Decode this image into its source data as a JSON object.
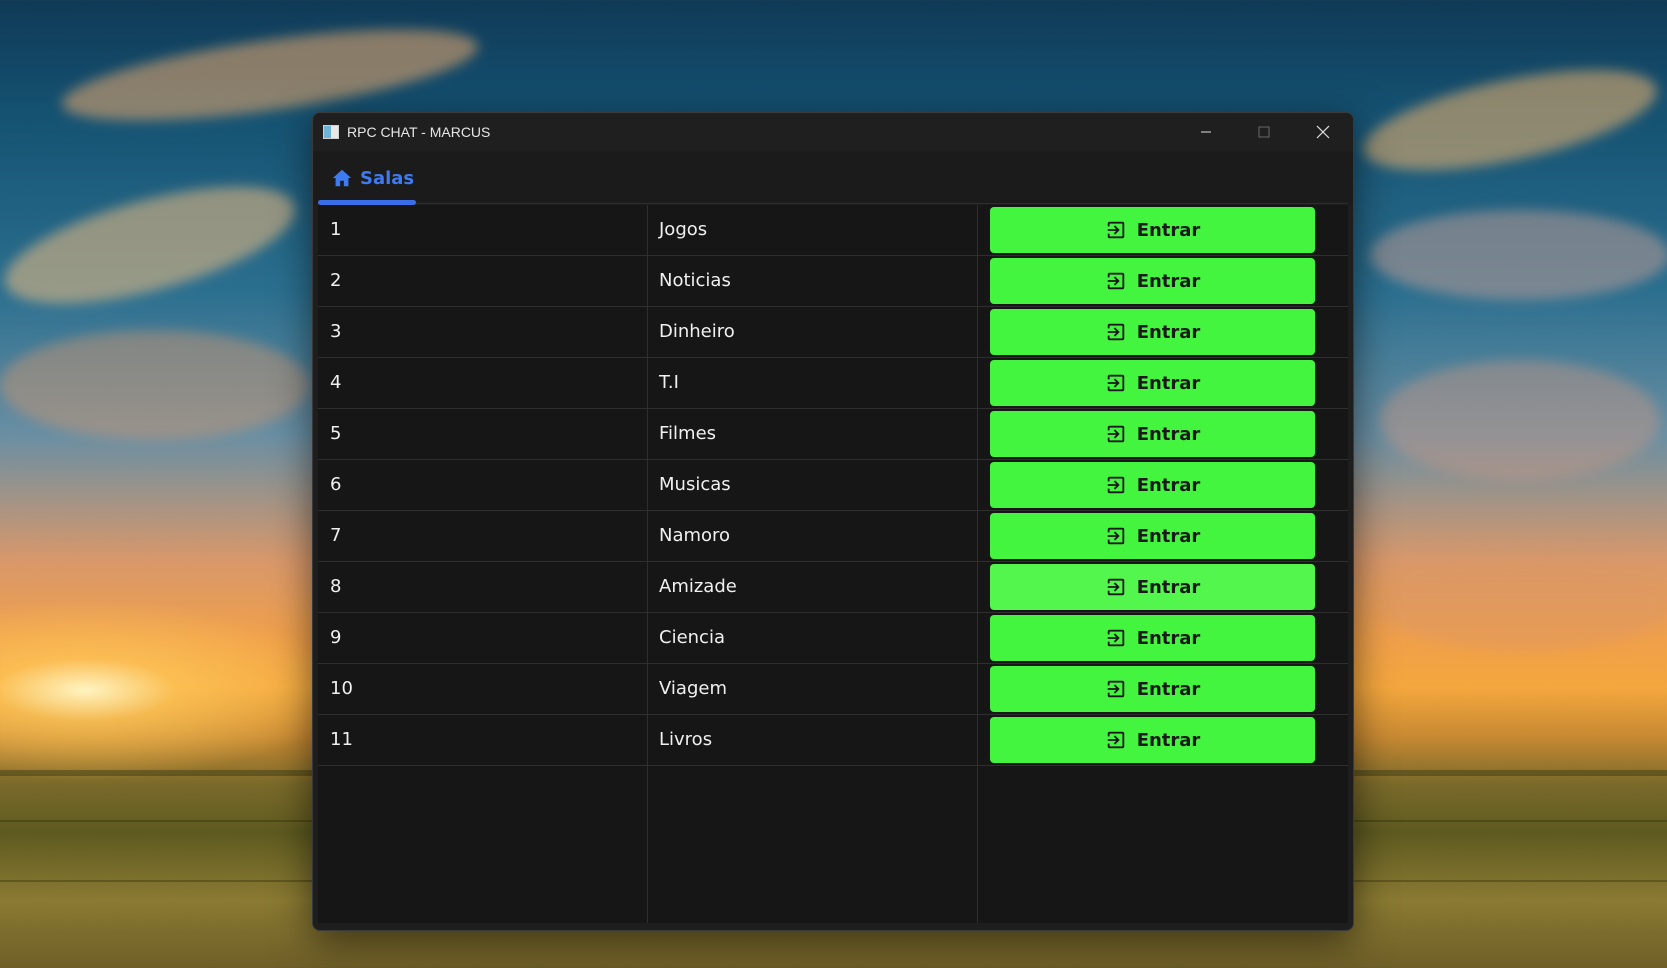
{
  "window": {
    "title": "RPC CHAT - MARCUS",
    "controls": {
      "minimize": "minimize-icon",
      "maximize": "maximize-icon",
      "close": "close-icon"
    }
  },
  "tabs": [
    {
      "label": "Salas",
      "icon": "home-icon",
      "active": true
    }
  ],
  "rooms": [
    {
      "id": "1",
      "name": "Jogos",
      "button": "Entrar"
    },
    {
      "id": "2",
      "name": "Noticias",
      "button": "Entrar"
    },
    {
      "id": "3",
      "name": "Dinheiro",
      "button": "Entrar"
    },
    {
      "id": "4",
      "name": "T.I",
      "button": "Entrar"
    },
    {
      "id": "5",
      "name": "Filmes",
      "button": "Entrar"
    },
    {
      "id": "6",
      "name": "Musicas",
      "button": "Entrar"
    },
    {
      "id": "7",
      "name": "Namoro",
      "button": "Entrar"
    },
    {
      "id": "8",
      "name": "Amizade",
      "button": "Entrar",
      "hovered": true
    },
    {
      "id": "9",
      "name": "Ciencia",
      "button": "Entrar"
    },
    {
      "id": "10",
      "name": "Viagem",
      "button": "Entrar"
    },
    {
      "id": "11",
      "name": "Livros",
      "button": "Entrar"
    }
  ],
  "button_icon": "login-icon",
  "colors": {
    "accent": "#3f7bf0",
    "button": "#44f53f",
    "button_hover": "#52f64d",
    "window_bg": "#1e1e1e",
    "table_bg": "#161616"
  }
}
